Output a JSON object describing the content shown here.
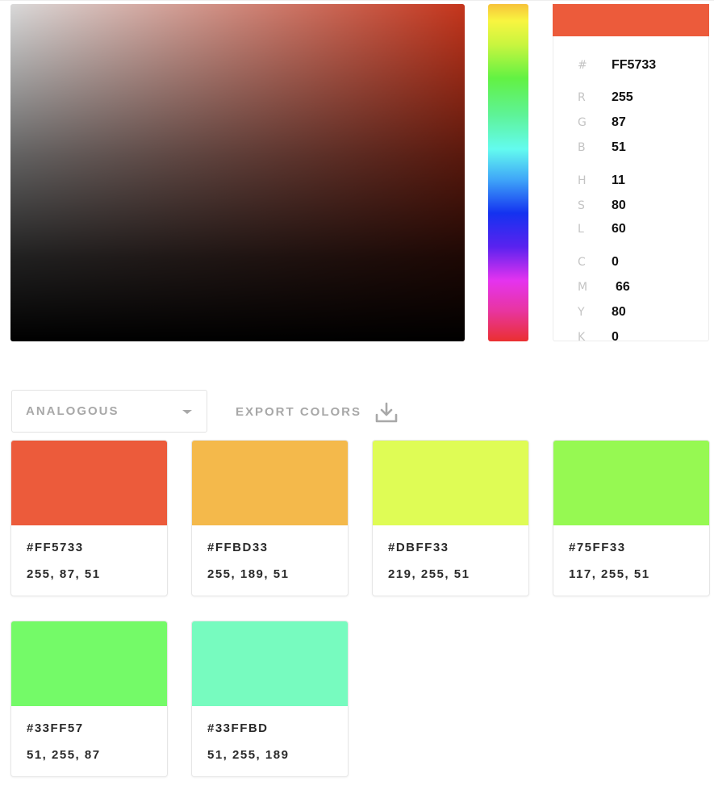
{
  "current_color": {
    "hex_symbol": "#",
    "hex": "FF5733",
    "swatch_color": "#ec5b3b",
    "hue_base_color": "#c5351c",
    "rgb": [
      {
        "label": "R",
        "value": "255"
      },
      {
        "label": "G",
        "value": "87"
      },
      {
        "label": "B",
        "value": "51"
      }
    ],
    "hsl": [
      {
        "label": "H",
        "value": "11"
      },
      {
        "label": "S",
        "value": "80"
      },
      {
        "label": "L",
        "value": "60"
      }
    ],
    "cmyk": [
      {
        "label": "C",
        "value": "0"
      },
      {
        "label": "M",
        "value": "66"
      },
      {
        "label": "Y",
        "value": "80"
      },
      {
        "label": "K",
        "value": "0"
      }
    ]
  },
  "controls": {
    "scheme_selected": "ANALOGOUS",
    "export_label": "EXPORT COLORS",
    "export_icon": "download-icon",
    "dropdown_icon": "caret-down-icon"
  },
  "palette": [
    {
      "hex": "#FF5733",
      "rgb": "255, 87, 51",
      "display_color": "#ec5b3b"
    },
    {
      "hex": "#FFBD33",
      "rgb": "255, 189, 51",
      "display_color": "#f4b94b"
    },
    {
      "hex": "#DBFF33",
      "rgb": "219, 255, 51",
      "display_color": "#dffc55"
    },
    {
      "hex": "#75FF33",
      "rgb": "117, 255, 51",
      "display_color": "#96f952"
    },
    {
      "hex": "#33FF57",
      "rgb": "51, 255, 87",
      "display_color": "#74fa68"
    },
    {
      "hex": "#33FFBD",
      "rgb": "51, 255, 189",
      "display_color": "#77fbbf"
    }
  ]
}
